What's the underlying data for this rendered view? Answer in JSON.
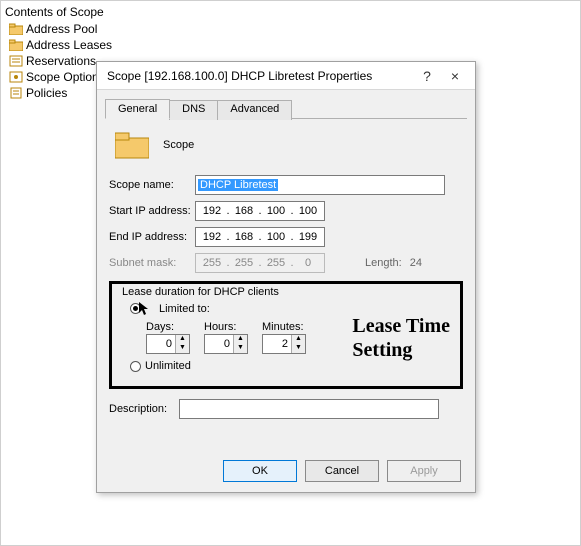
{
  "tree": {
    "header": "Contents of Scope",
    "items": [
      {
        "label": "Address Pool"
      },
      {
        "label": "Address Leases"
      },
      {
        "label": "Reservations"
      },
      {
        "label": "Scope Options"
      },
      {
        "label": "Policies"
      }
    ]
  },
  "dialog": {
    "title": "Scope [192.168.100.0] DHCP Libretest Properties",
    "help": "?",
    "close": "×",
    "tabs": {
      "general": "General",
      "dns": "DNS",
      "advanced": "Advanced"
    },
    "header_label": "Scope",
    "fields": {
      "scope_name_label": "Scope name:",
      "scope_name_value": "DHCP Libretest",
      "start_ip_label": "Start IP address:",
      "start_ip": {
        "o1": "192",
        "o2": "168",
        "o3": "100",
        "o4": "100"
      },
      "end_ip_label": "End IP address:",
      "end_ip": {
        "o1": "192",
        "o2": "168",
        "o3": "100",
        "o4": "199"
      },
      "subnet_label": "Subnet mask:",
      "subnet": {
        "o1": "255",
        "o2": "255",
        "o3": "255",
        "o4": "0"
      },
      "length_label": "Length:",
      "length_value": "24"
    },
    "lease": {
      "group_title": "Lease duration for DHCP clients",
      "limited_label": "Limited to:",
      "days_label": "Days:",
      "days_value": "0",
      "hours_label": "Hours:",
      "hours_value": "0",
      "minutes_label": "Minutes:",
      "minutes_value": "2",
      "unlimited_label": "Unlimited",
      "callout_line1": "Lease Time",
      "callout_line2": "Setting"
    },
    "description_label": "Description:",
    "description_value": "",
    "buttons": {
      "ok": "OK",
      "cancel": "Cancel",
      "apply": "Apply"
    }
  }
}
